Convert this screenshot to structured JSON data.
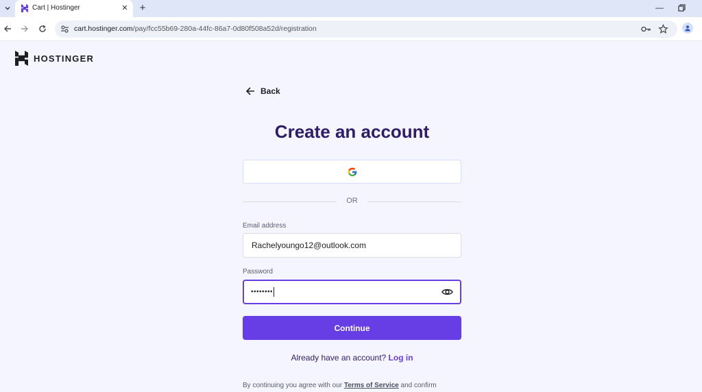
{
  "browser": {
    "tab_title": "Cart | Hostinger",
    "url_host": "cart.hostinger.com",
    "url_path": "/pay/fcc55b69-280a-44fc-86a7-0d80f508a52d/registration"
  },
  "brand": {
    "name": "HOSTINGER"
  },
  "back": {
    "label": "Back"
  },
  "title": "Create an account",
  "divider_text": "OR",
  "email": {
    "label": "Email address",
    "value": "Rachelyoungo12@outlook.com"
  },
  "password": {
    "label": "Password",
    "value": "••••••••"
  },
  "continue_label": "Continue",
  "login_prompt": {
    "text": "Already have an account?",
    "link": "Log in"
  },
  "terms": {
    "text_before": "By continuing you agree with our",
    "link": "Terms of Service",
    "text_after": "and confirm"
  },
  "colors": {
    "accent": "#673de6",
    "title": "#2f1c6a",
    "background": "#f4f5ff"
  }
}
